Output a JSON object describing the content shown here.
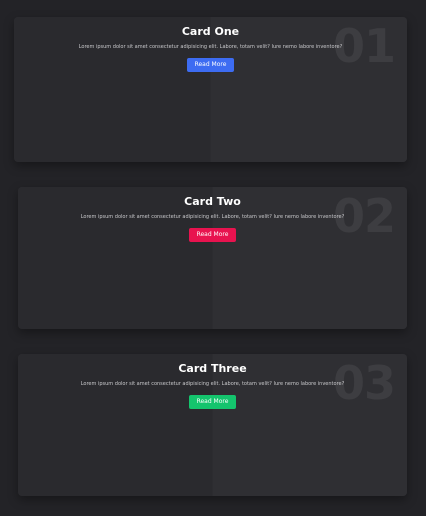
{
  "cards": [
    {
      "number": "01",
      "title": "Card One",
      "description": "Lorem ipsum dolor sit amet consectetur adipisicing elit. Labore, totam velit? Iure nemo labore inventore?",
      "button_label": "Read More",
      "button_color": "#3d6cf2"
    },
    {
      "number": "02",
      "title": "Card Two",
      "description": "Lorem ipsum dolor sit amet consectetur adipisicing elit. Labore, totam velit? Iure nemo labore inventore?",
      "button_label": "Read More",
      "button_color": "#e8134f"
    },
    {
      "number": "03",
      "title": "Card Three",
      "description": "Lorem ipsum dolor sit amet consectetur adipisicing elit. Labore, totam velit? Iure nemo labore inventore?",
      "button_label": "Read More",
      "button_color": "#14c46d"
    }
  ]
}
